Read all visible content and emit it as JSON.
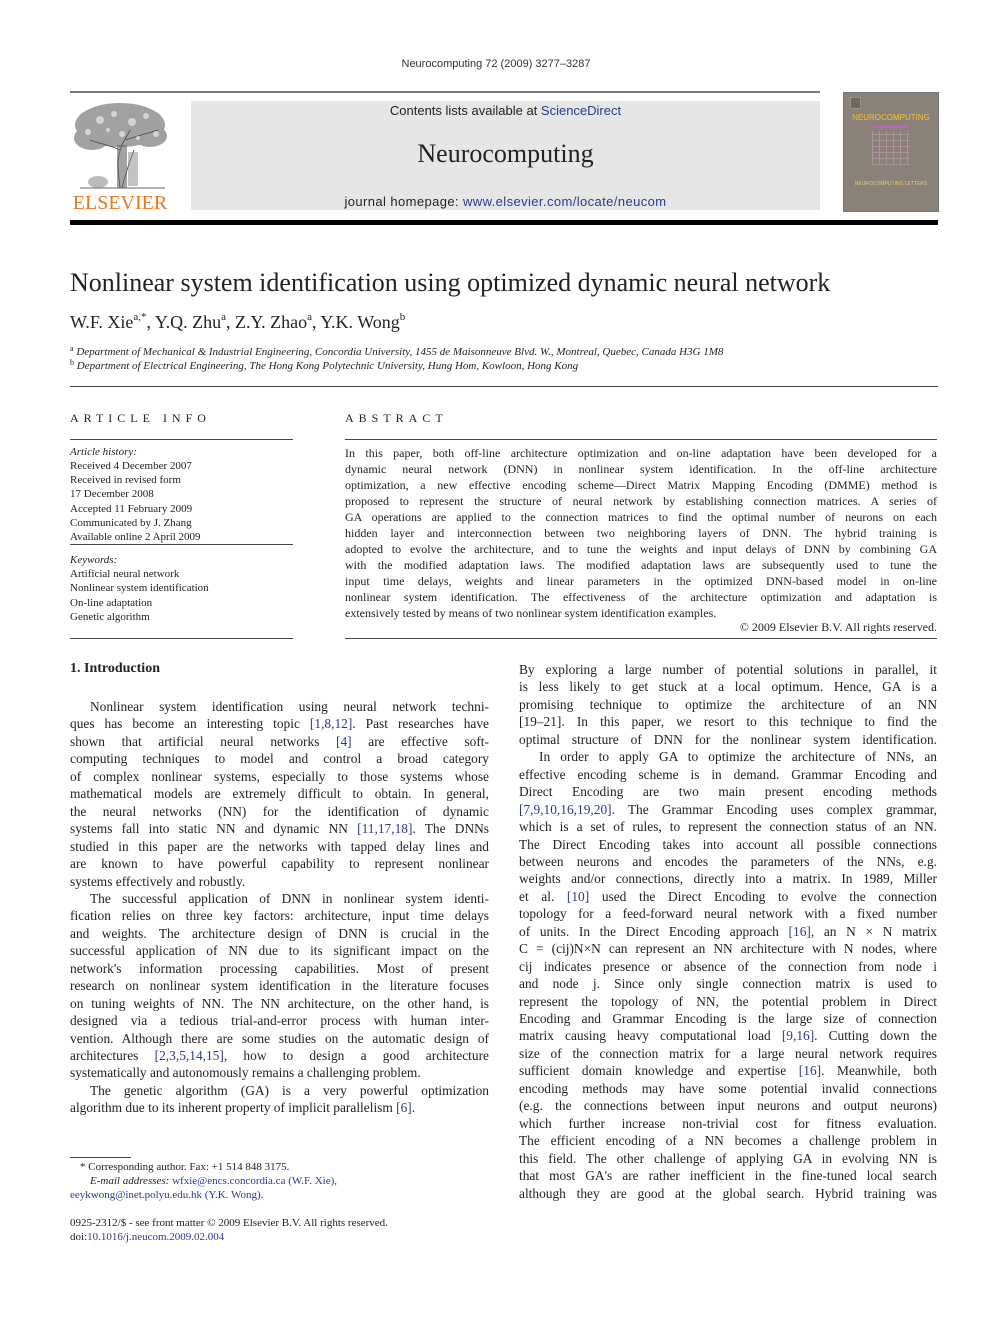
{
  "running_head": "Neurocomputing 72 (2009) 3277–3287",
  "masthead": {
    "publisher_logo_text": "ELSEVIER",
    "contents_prefix": "Contents lists available at ",
    "contents_link": "ScienceDirect",
    "journal_title": "Neurocomputing",
    "homepage_prefix": "journal homepage: ",
    "homepage_link": "www.elsevier.com/locate/neucom",
    "cover_title": "NEUROCOMPUTING",
    "cover_subtitle": "NEUROCOMPUTING LETTERS",
    "colors": {
      "publisher_orange": "#e87722",
      "link_blue": "#2b3a8c",
      "banner_gray": "#e6e6e6",
      "cover_brown": "#8a8178"
    }
  },
  "article": {
    "title": "Nonlinear system identification using optimized dynamic neural network",
    "authors": [
      {
        "name": "W.F. Xie",
        "sup": "a,*"
      },
      {
        "name": "Y.Q. Zhu",
        "sup": "a"
      },
      {
        "name": "Z.Y. Zhao",
        "sup": "a"
      },
      {
        "name": "Y.K. Wong",
        "sup": "b"
      }
    ],
    "affiliations": [
      {
        "mark": "a",
        "text": "Department of Mechanical & Industrial Engineering, Concordia University, 1455 de Maisonneuve Blvd. W., Montreal, Quebec, Canada H3G 1M8"
      },
      {
        "mark": "b",
        "text": "Department of Electrical Engineering, The Hong Kong Polytechnic University, Hung Hom, Kowloon, Hong Kong"
      }
    ]
  },
  "article_info": {
    "heading": "ARTICLE INFO",
    "history_label": "Article history:",
    "history": [
      "Received 4 December 2007",
      "Received in revised form",
      "17 December 2008",
      "Accepted 11 February 2009",
      "Communicated by J. Zhang",
      "Available online 2 April 2009"
    ],
    "keywords_label": "Keywords:",
    "keywords": [
      "Artificial neural network",
      "Nonlinear system identification",
      "On-line adaptation",
      "Genetic algorithm"
    ]
  },
  "abstract": {
    "heading": "ABSTRACT",
    "lines": [
      "In this paper, both off-line architecture optimization and on-line adaptation have been developed for a",
      "dynamic neural network (DNN) in nonlinear system identification. In the off-line architecture",
      "optimization, a new effective encoding scheme—Direct Matrix Mapping Encoding (DMME) method is",
      "proposed to represent the structure of neural network by establishing connection matrices. A series of",
      "GA operations are applied to the connection matrices to find the optimal number of neurons on each",
      "hidden layer and interconnection between two neighboring layers of DNN. The hybrid training is",
      "adopted to evolve the architecture, and to tune the weights and input delays of DNN by combining GA",
      "with the modified adaptation laws. The modified adaptation laws are subsequently used to tune the",
      "input time delays, weights and linear parameters in the optimized DNN-based model in on-line",
      "nonlinear system identification. The effectiveness of the architecture optimization and adaptation is",
      "extensively tested by means of two nonlinear system identification examples."
    ],
    "copyright": "© 2009 Elsevier B.V. All rights reserved."
  },
  "body": {
    "section_heading": "1.  Introduction",
    "col1_lines": [
      {
        "t": "Nonlinear system identification using neural network techni-",
        "indent": true
      },
      {
        "t": "ques has become an interesting topic [1,8,12]. Past researches have"
      },
      {
        "t": "shown that artificial neural networks [4] are effective soft-"
      },
      {
        "t": "computing techniques to model and control a broad category"
      },
      {
        "t": "of complex nonlinear systems, especially to those systems whose"
      },
      {
        "t": "mathematical models are extremely difficult to obtain. In general,"
      },
      {
        "t": "the neural networks (NN) for the identification of dynamic"
      },
      {
        "t": "systems fall into static NN and dynamic NN [11,17,18]. The DNNs"
      },
      {
        "t": "studied in this paper are the networks with tapped delay lines and"
      },
      {
        "t": "are known to have powerful capability to represent nonlinear"
      },
      {
        "t": "systems effectively and robustly.",
        "last": true
      },
      {
        "t": "The successful application of DNN in nonlinear system identi-",
        "indent": true
      },
      {
        "t": "fication relies on three key factors: architecture, input time delays"
      },
      {
        "t": "and weights. The architecture design of DNN is crucial in the"
      },
      {
        "t": "successful application of NN due to its significant impact on the"
      },
      {
        "t": "network's information processing capabilities. Most of present"
      },
      {
        "t": "research on nonlinear system identification in the literature focuses"
      },
      {
        "t": "on tuning weights of NN. The NN architecture, on the other hand, is"
      },
      {
        "t": "designed via a tedious trial-and-error process with human inter-"
      },
      {
        "t": "vention. Although there are some studies on the automatic design of"
      },
      {
        "t": "architectures [2,3,5,14,15], how to design a good architecture"
      },
      {
        "t": "systematically and autonomously remains a challenging problem.",
        "last": true
      },
      {
        "t": "The genetic algorithm (GA) is a very powerful optimization",
        "indent": true
      },
      {
        "t": "algorithm due to its inherent property of implicit parallelism [6]."
      }
    ],
    "col2_lines": [
      {
        "t": "By exploring a large number of potential solutions in parallel, it"
      },
      {
        "t": "is less likely to get stuck at a local optimum. Hence, GA is a"
      },
      {
        "t": "promising technique to optimize the architecture of an NN"
      },
      {
        "t": "[19–21]. In this paper, we resort to this technique to find the"
      },
      {
        "t": "optimal structure of DNN for the nonlinear system identification."
      },
      {
        "t": "In order to apply GA to optimize the architecture of NNs, an",
        "indent": true
      },
      {
        "t": "effective encoding scheme is in demand. Grammar Encoding and"
      },
      {
        "t": "Direct Encoding are two main present encoding methods"
      },
      {
        "t": "[7,9,10,16,19,20]. The Grammar Encoding uses complex grammar,"
      },
      {
        "t": "which is a set of rules, to represent the connection status of an NN."
      },
      {
        "t": "The Direct Encoding takes into account all possible connections"
      },
      {
        "t": "between neurons and encodes the parameters of the NNs, e.g."
      },
      {
        "t": "weights and/or connections, directly into a matrix. In 1989, Miller"
      },
      {
        "t": "et al. [10] used the Direct Encoding to evolve the connection"
      },
      {
        "t": "topology for a feed-forward neural network with a fixed number"
      },
      {
        "t": "of units. In the Direct Encoding approach [16], an N × N matrix"
      },
      {
        "t": "C = (cij)N×N can represent an NN architecture with N nodes, where"
      },
      {
        "t": "cij indicates presence or absence of the connection from node i"
      },
      {
        "t": "and node j. Since only single connection matrix is used to"
      },
      {
        "t": "represent the topology of NN, the potential problem in Direct"
      },
      {
        "t": "Encoding and Grammar Encoding is the large size of connection"
      },
      {
        "t": "matrix causing heavy computational load [9,16]. Cutting down the"
      },
      {
        "t": "size of the connection matrix for a large neural network requires"
      },
      {
        "t": "sufficient domain knowledge and expertise [16]. Meanwhile, both"
      },
      {
        "t": "encoding methods may have some potential invalid connections"
      },
      {
        "t": "(e.g. the connections between input neurons and output neurons)"
      },
      {
        "t": "which further increase non-trivial cost for fitness evaluation."
      },
      {
        "t": "The efficient encoding of a NN becomes a challenge problem in"
      },
      {
        "t": "this field. The other challenge of applying GA in evolving NN is"
      },
      {
        "t": "that most GA's are rather inefficient in the fine-tuned local search"
      },
      {
        "t": "although they are good at the global search. Hybrid training was"
      }
    ],
    "citations": [
      "[1,8,12]",
      "[4]",
      "[11,17,18]",
      "[2,3,5,14,15]",
      "[6]",
      "[7,9,10,16,19,20]",
      "[10]",
      "[16]",
      "[9,16]"
    ]
  },
  "footnotes": {
    "corresponding": "* Corresponding author. Fax: +1 514 848 3175.",
    "email_label": "E-mail addresses: ",
    "email1": "wfxie@encs.concordia.ca",
    "email1_owner": " (W.F. Xie),",
    "email2": "eeykwong@inet.polyu.edu.hk",
    "email2_owner": " (Y.K. Wong).",
    "issn": "0925-2312/$ - see front matter © 2009 Elsevier B.V. All rights reserved.",
    "doi_prefix": "doi:",
    "doi": "10.1016/j.neucom.2009.02.004"
  }
}
